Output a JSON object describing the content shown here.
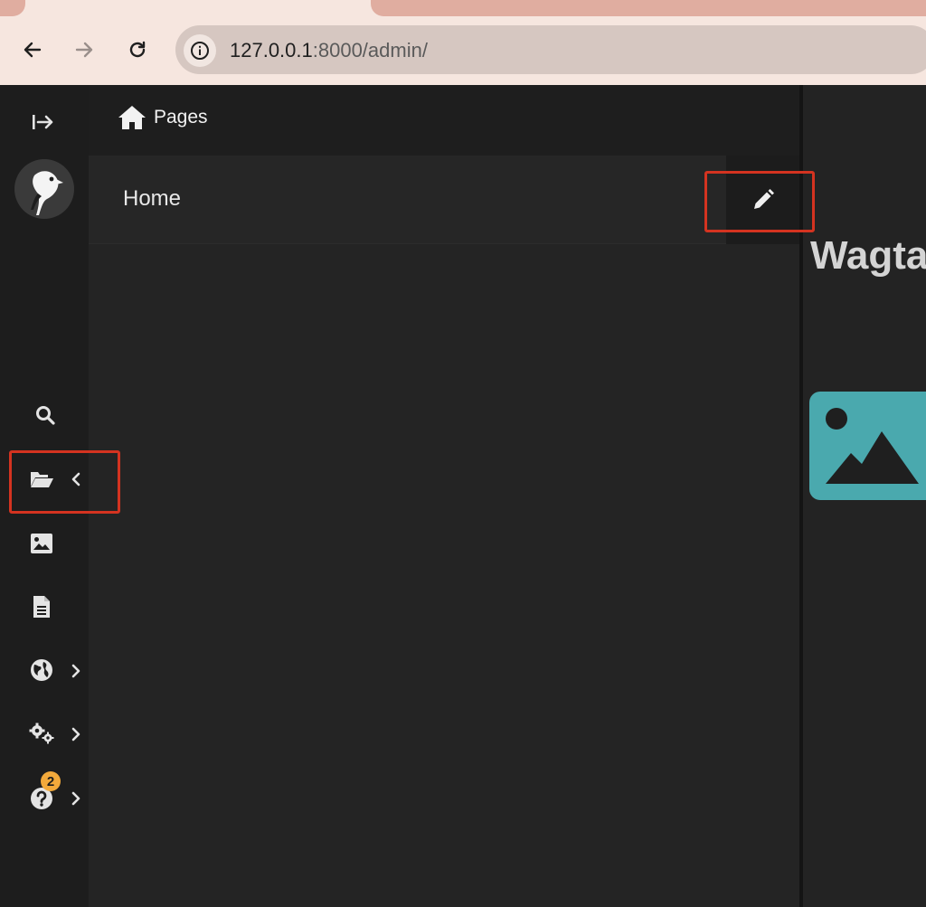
{
  "browser": {
    "url_host": "127.0.0.1",
    "url_rest": ":8000/admin/",
    "back_icon": "arrow-left-icon",
    "forward_icon": "arrow-right-icon",
    "reload_icon": "reload-icon",
    "info_icon": "info-icon"
  },
  "sidebar": {
    "items": [
      {
        "name": "collapse-sidebar",
        "icon": "expand-right-icon"
      },
      {
        "name": "logo",
        "icon": "wagtail-logo"
      },
      {
        "name": "search",
        "icon": "search-icon"
      },
      {
        "name": "pages",
        "icon": "folder-open-icon",
        "expanded": true
      },
      {
        "name": "images",
        "icon": "image-icon"
      },
      {
        "name": "documents",
        "icon": "document-icon"
      },
      {
        "name": "sites",
        "icon": "globe-icon"
      },
      {
        "name": "settings",
        "icon": "cogs-icon"
      },
      {
        "name": "help",
        "icon": "help-icon"
      }
    ],
    "help_badge": "2"
  },
  "explorer": {
    "breadcrumb_label": "Pages",
    "home_label": "Home",
    "edit_icon": "pencil-icon"
  },
  "main": {
    "title": "Wagta"
  },
  "colors": {
    "accent_annotation": "#d43320",
    "badge": "#f2a93b",
    "image_card": "#4aa9ae"
  }
}
